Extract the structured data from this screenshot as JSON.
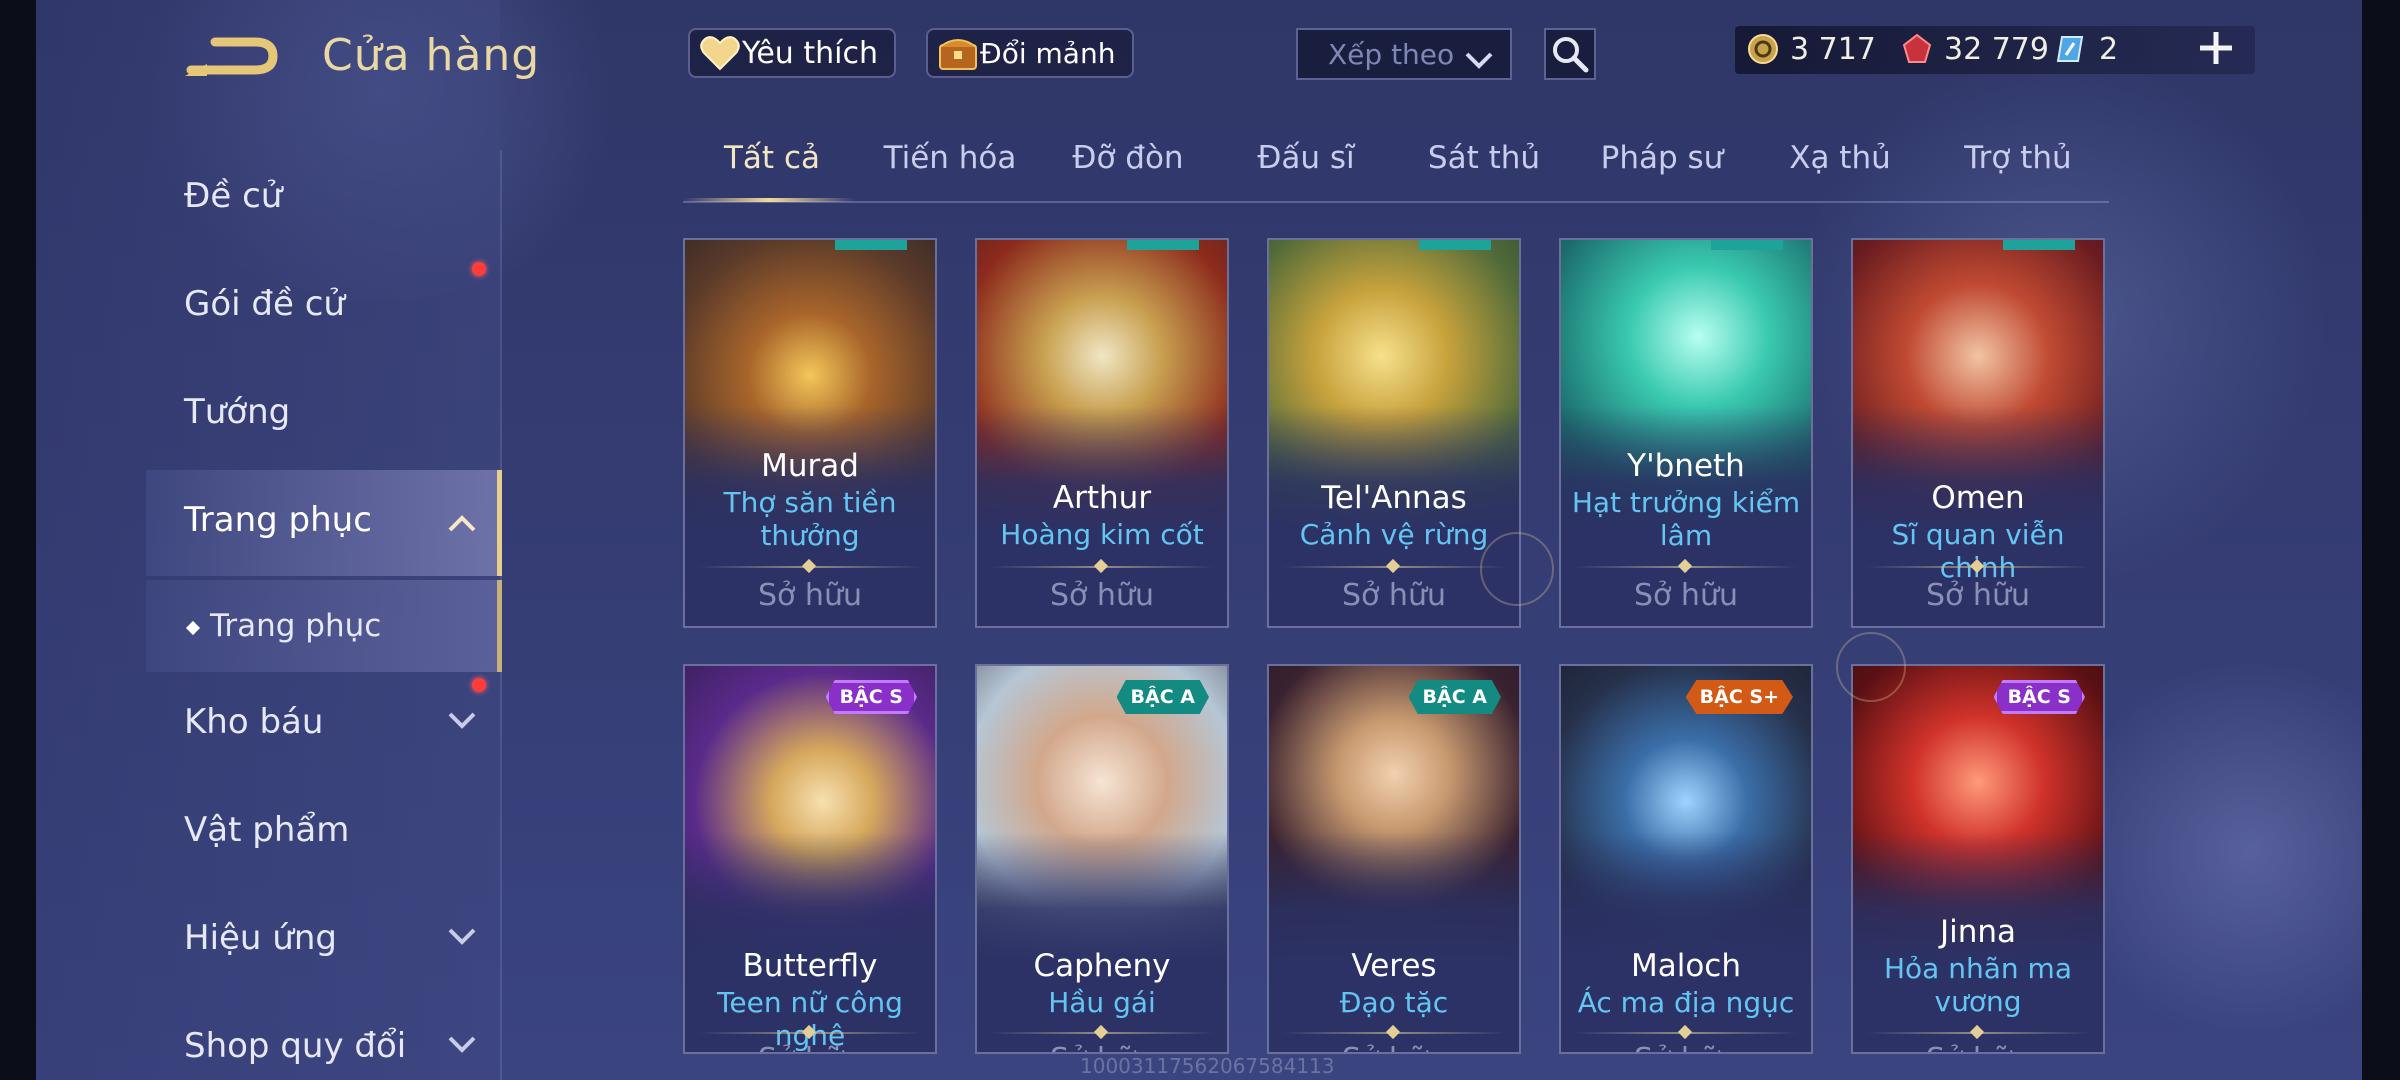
{
  "header": {
    "title": "Cửa hàng"
  },
  "top_buttons": {
    "favorite": "Yêu thích",
    "exchange": "Đổi mảnh"
  },
  "sort": {
    "label": "Xếp theo"
  },
  "currency": {
    "coins": "3 717",
    "gems": "32 779",
    "tickets": "2"
  },
  "sidebar": {
    "items": [
      {
        "label": "Đề cử"
      },
      {
        "label": "Gói đề cử"
      },
      {
        "label": "Tướng"
      },
      {
        "label": "Trang phục"
      },
      {
        "label": "Kho báu"
      },
      {
        "label": "Vật phẩm"
      },
      {
        "label": "Hiệu ứng"
      },
      {
        "label": "Shop quy đổi"
      }
    ],
    "sub_item": "Trang phục"
  },
  "tabs": [
    "Tất cả",
    "Tiến hóa",
    "Đỡ đòn",
    "Đấu sĩ",
    "Sát thủ",
    "Pháp sư",
    "Xạ thủ",
    "Trợ thủ"
  ],
  "cards": [
    {
      "hero": "Murad",
      "skin": "Thợ săn tiền thưởng",
      "status": "Sở hữu"
    },
    {
      "hero": "Arthur",
      "skin": "Hoàng kim cốt",
      "status": "Sở hữu"
    },
    {
      "hero": "Tel'Annas",
      "skin": "Cảnh vệ rừng",
      "status": "Sở hữu"
    },
    {
      "hero": "Y'bneth",
      "skin": "Hạt trưởng kiểm lâm",
      "status": "Sở hữu"
    },
    {
      "hero": "Omen",
      "skin": "Sĩ quan viễn chinh",
      "status": "Sở hữu"
    },
    {
      "hero": "Butterfly",
      "skin": "Teen nữ công nghệ",
      "status": "Sở hữu",
      "badge": "BẬC S"
    },
    {
      "hero": "Capheny",
      "skin": "Hầu gái",
      "status": "Sở hữu",
      "badge": "BẬC A"
    },
    {
      "hero": "Veres",
      "skin": "Đạo tặc",
      "status": "Sở hữu",
      "badge": "BẬC A"
    },
    {
      "hero": "Maloch",
      "skin": "Ác ma địa ngục",
      "status": "Sở hữu",
      "badge": "BẬC S+"
    },
    {
      "hero": "Jinna",
      "skin": "Hỏa nhãn ma vương",
      "status": "Sở hữu",
      "badge": "BẬC S"
    }
  ],
  "watermark": "10003117562067584113",
  "colors": {
    "accent_gold": "#e8cf8e",
    "skin_name": "#63c5f2",
    "notification": "#ff3b3b"
  }
}
